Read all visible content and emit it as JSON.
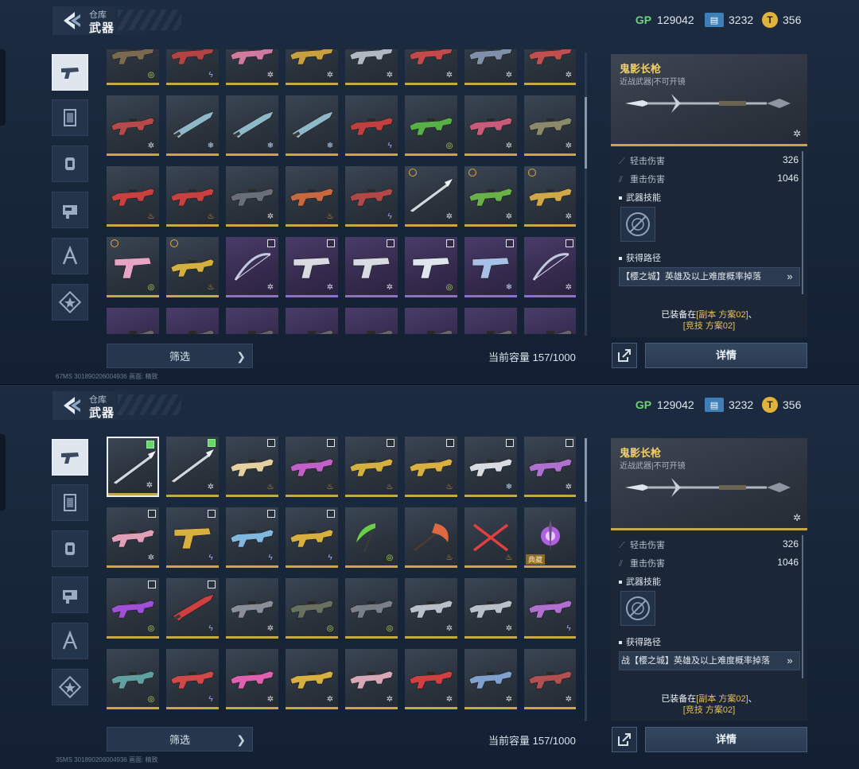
{
  "panels": [
    {
      "header": {
        "breadcrumb": "仓库",
        "title": "武器"
      },
      "currencies": [
        {
          "icon": "gp-icon",
          "label": "GP",
          "value": "129042"
        },
        {
          "icon": "ticket-icon",
          "value": "3232"
        },
        {
          "icon": "coin-icon",
          "value": "356"
        }
      ],
      "categories": [
        {
          "name": "category-pistol",
          "icon": "pistol-icon",
          "active": true
        },
        {
          "name": "category-card",
          "icon": "card-icon"
        },
        {
          "name": "category-grenade",
          "icon": "grenade-icon"
        },
        {
          "name": "category-device",
          "icon": "device-icon"
        },
        {
          "name": "category-character",
          "icon": "character-icon"
        },
        {
          "name": "category-badge",
          "icon": "badge-icon"
        }
      ],
      "grid": {
        "rows": [
          {
            "partial": "top",
            "cells": [
              {
                "type": "rifle",
                "color": "#7a6a52",
                "badge": "aim"
              },
              {
                "type": "rifle",
                "color": "#b04444",
                "badge": "bolt"
              },
              {
                "type": "rifle",
                "color": "#d07aa0",
                "badge": "star"
              },
              {
                "type": "rifle",
                "color": "#c9a040",
                "badge": "star"
              },
              {
                "type": "rifle",
                "color": "#b0b8c4",
                "badge": "star"
              },
              {
                "type": "rifle",
                "color": "#c24a4a",
                "badge": "star"
              },
              {
                "type": "rifle",
                "color": "#8090a8",
                "badge": "star"
              },
              {
                "type": "rifle",
                "color": "#c05050",
                "badge": "star"
              }
            ]
          },
          {
            "cells": [
              {
                "type": "rifle",
                "color": "#b44a4a",
                "badge": "star"
              },
              {
                "type": "knife",
                "color": "#8fb8c8",
                "badge": "ice"
              },
              {
                "type": "knife",
                "color": "#8fb8c8",
                "badge": "ice"
              },
              {
                "type": "knife",
                "color": "#8fb8c8",
                "badge": "ice"
              },
              {
                "type": "rifle",
                "color": "#c04040",
                "badge": "bolt"
              },
              {
                "type": "rifle",
                "color": "#56b046",
                "badge": "aim"
              },
              {
                "type": "rifle",
                "color": "#c85a7a",
                "badge": "star"
              },
              {
                "type": "rifle",
                "color": "#8a8a6a",
                "badge": "star"
              }
            ]
          },
          {
            "cells": [
              {
                "type": "rifle",
                "color": "#c84040",
                "badge": "fire"
              },
              {
                "type": "rifle",
                "color": "#c84040",
                "badge": "fire"
              },
              {
                "type": "rifle",
                "color": "#6a6e78",
                "badge": "star"
              },
              {
                "type": "rifle",
                "color": "#c86840",
                "badge": "fire"
              },
              {
                "type": "rifle",
                "color": "#b04848",
                "badge": "bolt"
              },
              {
                "type": "spear",
                "color": "#cfd6de",
                "badge": "star",
                "clock": true
              },
              {
                "type": "rifle",
                "color": "#6ab048",
                "badge": "star",
                "clock": true
              },
              {
                "type": "rifle",
                "color": "#d0a848",
                "badge": "star",
                "clock": true
              }
            ]
          },
          {
            "cells": [
              {
                "type": "pistol",
                "color": "#e8a4c4",
                "badge": "aim",
                "clock": true
              },
              {
                "type": "rifle",
                "color": "#d4b040",
                "badge": "fire",
                "clock": true
              },
              {
                "type": "bow",
                "color": "#c0c8e0",
                "badge": "star",
                "purple": true,
                "check": "off"
              },
              {
                "type": "pistol",
                "color": "#d8dce2",
                "badge": "star",
                "purple": true,
                "check": "off"
              },
              {
                "type": "pistol",
                "color": "#d8dce2",
                "badge": "star",
                "purple": true,
                "check": "off"
              },
              {
                "type": "pistol",
                "color": "#e0e6ee",
                "badge": "aim",
                "purple": true,
                "check": "off"
              },
              {
                "type": "pistol",
                "color": "#a8c0e8",
                "badge": "ice",
                "purple": true,
                "check": "off"
              },
              {
                "type": "bow",
                "color": "#c0c8e0",
                "badge": "star",
                "purple": true,
                "check": "off"
              }
            ]
          },
          {
            "partial": "bottom",
            "cells": [
              {
                "type": "rifle",
                "color": "#6a6470",
                "purple": true
              },
              {
                "type": "rifle",
                "color": "#6a6470",
                "purple": true
              },
              {
                "type": "rifle",
                "color": "#6a6470",
                "purple": true
              },
              {
                "type": "rifle",
                "color": "#6a6470",
                "purple": true
              },
              {
                "type": "rifle",
                "color": "#6a6470",
                "purple": true
              },
              {
                "type": "rifle",
                "color": "#6a6470",
                "purple": true
              },
              {
                "type": "rifle",
                "color": "#6a6470",
                "purple": true
              },
              {
                "type": "rifle",
                "color": "#6a6470",
                "purple": true
              }
            ]
          }
        ]
      },
      "filter_label": "筛选",
      "capacity": "当前容量 157/1000",
      "debug": "67MS  301890206004936        画面: 精致",
      "detail": {
        "weapon_name": "鬼影长枪",
        "weapon_sub": "近战武器|不可开镜",
        "stats": [
          {
            "label": "轻击伤害",
            "value": "326"
          },
          {
            "label": "重击伤害",
            "value": "1046"
          }
        ],
        "skill_title": "武器技能",
        "source_title": "获得路径",
        "source_text": "【樱之城】英雄及以上难度概率掉落",
        "equipped_prefix": "已装备在",
        "equipped_1": "[副本 方案02]",
        "equipped_sep": "、",
        "equipped_2": "[竞技 方案02]",
        "details_label": "详情"
      }
    },
    {
      "header": {
        "breadcrumb": "仓库",
        "title": "武器"
      },
      "currencies": [
        {
          "icon": "gp-icon",
          "label": "GP",
          "value": "129042"
        },
        {
          "icon": "ticket-icon",
          "value": "3232"
        },
        {
          "icon": "coin-icon",
          "value": "356"
        }
      ],
      "categories": [
        {
          "name": "category-pistol",
          "icon": "pistol-icon",
          "active": true
        },
        {
          "name": "category-card",
          "icon": "card-icon"
        },
        {
          "name": "category-grenade",
          "icon": "grenade-icon"
        },
        {
          "name": "category-device",
          "icon": "device-icon"
        },
        {
          "name": "category-character",
          "icon": "character-icon"
        },
        {
          "name": "category-badge",
          "icon": "badge-icon"
        }
      ],
      "grid": {
        "rows": [
          {
            "cells": [
              {
                "type": "spear",
                "color": "#cfd6de",
                "badge": "star",
                "selected": true,
                "check": "on"
              },
              {
                "type": "spear",
                "color": "#cfd6de",
                "badge": "star",
                "check": "on"
              },
              {
                "type": "rifle",
                "color": "#e6d0a0",
                "badge": "fire",
                "check": "off"
              },
              {
                "type": "rifle",
                "color": "#c060c8",
                "badge": "fire",
                "check": "off"
              },
              {
                "type": "rifle",
                "color": "#d4b040",
                "badge": "fire",
                "check": "off"
              },
              {
                "type": "rifle",
                "color": "#d8b040",
                "badge": "fire",
                "check": "off"
              },
              {
                "type": "rifle",
                "color": "#d8dce2",
                "badge": "ice",
                "check": "off"
              },
              {
                "type": "rifle",
                "color": "#b070d0",
                "badge": "star",
                "check": "off"
              }
            ]
          },
          {
            "cells": [
              {
                "type": "rifle",
                "color": "#e0a0b8",
                "badge": "star",
                "check": "off"
              },
              {
                "type": "pistol",
                "color": "#d8b040",
                "badge": "bolt",
                "check": "off"
              },
              {
                "type": "rifle",
                "color": "#80b8e0",
                "badge": "bolt",
                "check": "off"
              },
              {
                "type": "rifle",
                "color": "#d8b040",
                "badge": "bolt",
                "check": "off"
              },
              {
                "type": "scythe",
                "color": "#6ad048",
                "badge": "aim"
              },
              {
                "type": "axe",
                "color": "#e06840",
                "badge": "fire"
              },
              {
                "type": "cross",
                "color": "#e04040",
                "badge": "fire"
              },
              {
                "type": "orb",
                "color": "#b060e0",
                "tag": "典藏"
              }
            ]
          },
          {
            "cells": [
              {
                "type": "rifle",
                "color": "#a050d8",
                "badge": "aim",
                "check": "off"
              },
              {
                "type": "knife",
                "color": "#d04040",
                "badge": "bolt",
                "check": "off"
              },
              {
                "type": "rifle",
                "color": "#8a8e98",
                "badge": "star"
              },
              {
                "type": "rifle",
                "color": "#6a7060",
                "badge": "aim"
              },
              {
                "type": "rifle",
                "color": "#7a7e88",
                "badge": "aim"
              },
              {
                "type": "rifle",
                "color": "#b8c0cc",
                "badge": "star"
              },
              {
                "type": "rifle",
                "color": "#b8c0cc",
                "badge": "star"
              },
              {
                "type": "rifle",
                "color": "#b070d0",
                "badge": "bolt"
              }
            ]
          },
          {
            "cells": [
              {
                "type": "rifle",
                "color": "#60a0a0",
                "badge": "aim"
              },
              {
                "type": "rifle",
                "color": "#d04848",
                "badge": "bolt"
              },
              {
                "type": "rifle",
                "color": "#e060b0",
                "badge": "star"
              },
              {
                "type": "rifle",
                "color": "#d8b040",
                "badge": "star"
              },
              {
                "type": "rifle",
                "color": "#d8a8b8",
                "badge": "star"
              },
              {
                "type": "rifle",
                "color": "#d04040",
                "badge": "star"
              },
              {
                "type": "rifle",
                "color": "#80a0d0",
                "badge": "star"
              },
              {
                "type": "rifle",
                "color": "#b05050",
                "badge": "star"
              }
            ]
          }
        ]
      },
      "filter_label": "筛选",
      "capacity": "当前容量 157/1000",
      "debug": "35MS  301890206004936        画面: 精致",
      "detail": {
        "weapon_name": "鬼影长枪",
        "weapon_sub": "近战武器|不可开镜",
        "stats": [
          {
            "label": "轻击伤害",
            "value": "326"
          },
          {
            "label": "重击伤害",
            "value": "1046"
          }
        ],
        "skill_title": "武器技能",
        "source_title": "获得路径",
        "source_text": "战【樱之城】英雄及以上难度概率掉落",
        "equipped_prefix": "已装备在",
        "equipped_1": "[副本 方案02]",
        "equipped_sep": "、",
        "equipped_2": "[竞技 方案02]",
        "details_label": "详情"
      }
    }
  ],
  "badges": {
    "star": "✲",
    "ice": "❄",
    "fire": "♨",
    "bolt": "ϟ",
    "aim": "◎"
  },
  "badge_colors": {
    "star": "#d6dde6",
    "ice": "#b8d8f4",
    "fire": "#e8b048",
    "bolt": "#9aa8ff",
    "aim": "#b4e05a"
  },
  "colors": {
    "accent_gold": "#caa34a",
    "gp_green": "#6fd27a",
    "highlight": "#e8c15c"
  }
}
